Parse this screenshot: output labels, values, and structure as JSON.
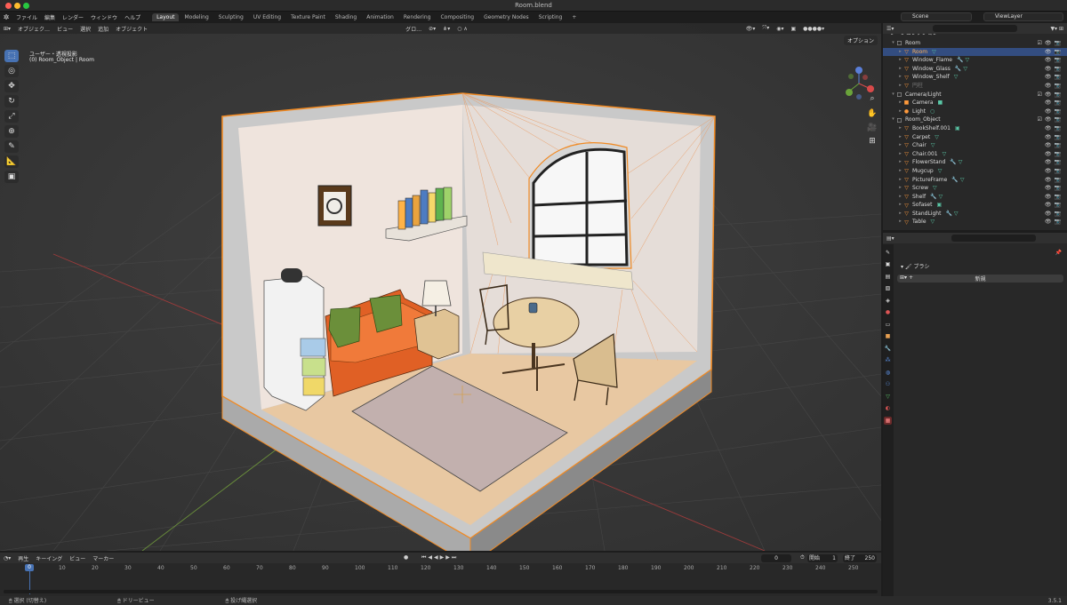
{
  "window": {
    "title": "Room.blend"
  },
  "menu": {
    "items": [
      "ファイル",
      "編集",
      "レンダー",
      "ウィンドウ",
      "ヘルプ"
    ],
    "workspaces": [
      "Layout",
      "Modeling",
      "Sculpting",
      "UV Editing",
      "Texture Paint",
      "Shading",
      "Animation",
      "Rendering",
      "Compositing",
      "Geometry Nodes",
      "Scripting"
    ],
    "active_workspace": "Layout",
    "add_tab": "+",
    "scene": "Scene",
    "view_layer": "ViewLayer"
  },
  "viewport": {
    "mode": "オブジェク…",
    "menu": [
      "ビュー",
      "選択",
      "追加",
      "オブジェクト"
    ],
    "transform": "グロ…",
    "view_name": "ユーザー・透視投影",
    "context": "(0) Room_Object | Room",
    "options": "オプション",
    "gizmo": {
      "x": "X",
      "y": "Y",
      "z": "Z"
    }
  },
  "outliner": {
    "root": "シーンコレクション",
    "rows": [
      {
        "label": "Room",
        "type": "collection",
        "depth": 1,
        "open": true
      },
      {
        "label": "Room",
        "type": "object",
        "depth": 2,
        "selected": true,
        "extra": [
          "▽"
        ]
      },
      {
        "label": "Window_Flame",
        "type": "object",
        "depth": 2,
        "extra": [
          "🔧",
          "▽"
        ]
      },
      {
        "label": "Window_Glass",
        "type": "object",
        "depth": 2,
        "extra": [
          "🔧",
          "▽"
        ]
      },
      {
        "label": "Window_Shelf",
        "type": "object",
        "depth": 2,
        "extra": [
          "▽"
        ]
      },
      {
        "label": "円柱",
        "type": "object",
        "depth": 2,
        "dim": true,
        "extra": []
      },
      {
        "label": "Camera/Light",
        "type": "collection",
        "depth": 1,
        "open": true
      },
      {
        "label": "Camera",
        "type": "camera",
        "depth": 2,
        "extra": [
          "■"
        ]
      },
      {
        "label": "Light",
        "type": "light",
        "depth": 2,
        "extra": [
          "○"
        ]
      },
      {
        "label": "Room_Object",
        "type": "collection",
        "depth": 1,
        "open": true
      },
      {
        "label": "BookShelf.001",
        "type": "object",
        "depth": 2,
        "extra": [
          "▣"
        ]
      },
      {
        "label": "Carpet",
        "type": "object",
        "depth": 2,
        "extra": [
          "▽"
        ]
      },
      {
        "label": "Chair",
        "type": "object",
        "depth": 2,
        "extra": [
          "▽"
        ]
      },
      {
        "label": "Chair.001",
        "type": "object",
        "depth": 2,
        "extra": [
          "▽"
        ]
      },
      {
        "label": "FlowerStand",
        "type": "object",
        "depth": 2,
        "extra": [
          "🔧",
          "▽"
        ]
      },
      {
        "label": "Mugcup",
        "type": "object",
        "depth": 2,
        "extra": [
          "▽"
        ]
      },
      {
        "label": "PictureFrame",
        "type": "object",
        "depth": 2,
        "extra": [
          "🔧",
          "▽"
        ]
      },
      {
        "label": "Screw",
        "type": "object",
        "depth": 2,
        "extra": [
          "▽"
        ]
      },
      {
        "label": "Shelf",
        "type": "object",
        "depth": 2,
        "extra": [
          "🔧",
          "▽"
        ]
      },
      {
        "label": "Sofaset",
        "type": "object",
        "depth": 2,
        "extra": [
          "▣"
        ]
      },
      {
        "label": "StandLight",
        "type": "object",
        "depth": 2,
        "extra": [
          "🔧",
          "▽"
        ]
      },
      {
        "label": "Table",
        "type": "object",
        "depth": 2,
        "extra": [
          "▽"
        ]
      }
    ]
  },
  "properties": {
    "brush_label": "ブラシ",
    "new_button": "新規"
  },
  "timeline": {
    "menu": [
      "再生",
      "キーイング",
      "ビュー",
      "マーカー"
    ],
    "current_frame": "0",
    "start_label": "開始",
    "start": "1",
    "end_label": "終了",
    "end": "250",
    "ticks": [
      "10",
      "20",
      "30",
      "40",
      "50",
      "60",
      "70",
      "80",
      "90",
      "100",
      "110",
      "120",
      "130",
      "140",
      "150",
      "160",
      "170",
      "180",
      "190",
      "200",
      "210",
      "220",
      "230",
      "240",
      "250"
    ],
    "playhead_label": "0"
  },
  "status": {
    "select": "選択 (切替え)",
    "dolly": "ドリービュー",
    "lasso": "投げ縄選択",
    "version": "3.5.1"
  }
}
